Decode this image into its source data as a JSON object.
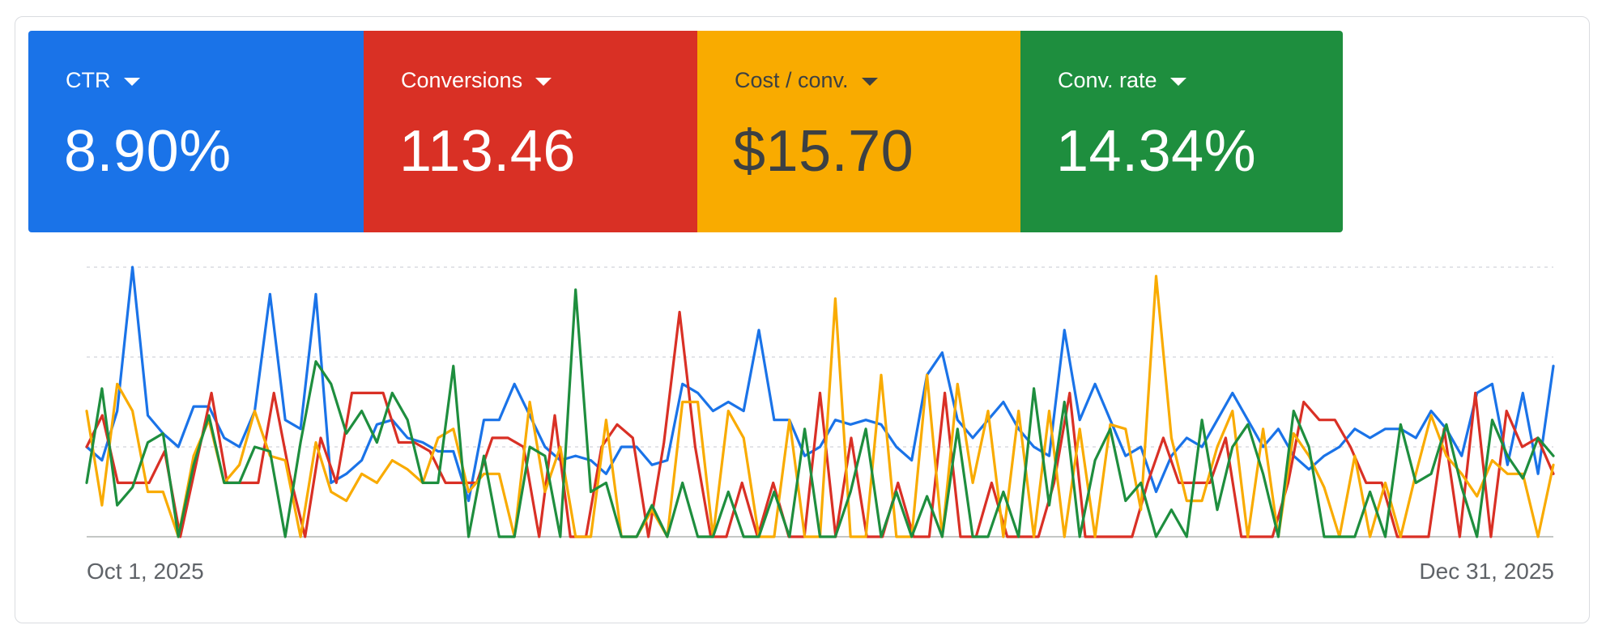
{
  "metrics": [
    {
      "label": "CTR",
      "value": "8.90%",
      "color": "#1a73e8",
      "text_color": "#ffffff"
    },
    {
      "label": "Conversions",
      "value": "113.46",
      "color": "#d93025",
      "text_color": "#ffffff"
    },
    {
      "label": "Cost / conv.",
      "value": "$15.70",
      "color": "#f9ab00",
      "text_color": "#3c4043"
    },
    {
      "label": "Conv. rate",
      "value": "14.34%",
      "color": "#1e8e3e",
      "text_color": "#ffffff"
    }
  ],
  "chart_data": {
    "type": "line",
    "x_start_label": "Oct 1, 2025",
    "x_end_label": "Dec 31, 2025",
    "ylim": [
      0,
      3
    ],
    "grid": true,
    "series": [
      {
        "color": "#1a73e8",
        "values": [
          1.0,
          0.85,
          1.4,
          3.0,
          1.35,
          1.15,
          1.0,
          1.45,
          1.45,
          1.1,
          1.0,
          1.4,
          2.7,
          1.3,
          1.2,
          2.7,
          0.6,
          0.7,
          0.85,
          1.25,
          1.3,
          1.1,
          1.05,
          0.95,
          0.95,
          0.4,
          1.3,
          1.3,
          1.7,
          1.35,
          1.0,
          0.85,
          0.9,
          0.85,
          0.7,
          1.0,
          1.0,
          0.8,
          0.85,
          1.7,
          1.6,
          1.4,
          1.5,
          1.4,
          2.3,
          1.3,
          1.3,
          0.9,
          1.0,
          1.3,
          1.25,
          1.3,
          1.25,
          1.0,
          0.85,
          1.8,
          2.05,
          1.3,
          1.1,
          1.3,
          1.5,
          1.2,
          1.0,
          0.9,
          2.3,
          1.3,
          1.7,
          1.3,
          0.9,
          1.0,
          0.5,
          0.9,
          1.1,
          1.0,
          1.3,
          1.6,
          1.3,
          1.0,
          1.2,
          0.9,
          0.75,
          0.9,
          1.0,
          1.2,
          1.1,
          1.2,
          1.2,
          1.1,
          1.4,
          1.2,
          0.9,
          1.6,
          1.7,
          0.8,
          1.6,
          0.7,
          1.9
        ]
      },
      {
        "color": "#d93025",
        "values": [
          1.0,
          1.35,
          0.6,
          0.6,
          0.6,
          0.95,
          0.0,
          0.8,
          1.6,
          0.6,
          0.6,
          0.6,
          1.6,
          0.7,
          0.0,
          1.1,
          0.6,
          1.6,
          1.6,
          1.6,
          1.05,
          1.05,
          0.95,
          0.6,
          0.6,
          0.6,
          1.1,
          1.1,
          1.0,
          0.0,
          1.35,
          0.0,
          0.0,
          1.0,
          1.25,
          1.1,
          0.0,
          1.05,
          2.5,
          1.0,
          0.0,
          0.0,
          0.6,
          0.0,
          0.6,
          0.0,
          0.0,
          1.6,
          0.0,
          1.1,
          0.0,
          0.0,
          0.6,
          0.0,
          0.0,
          1.6,
          0.0,
          0.0,
          0.6,
          0.0,
          0.0,
          0.0,
          0.6,
          1.6,
          0.0,
          0.0,
          0.0,
          0.0,
          0.6,
          1.1,
          0.6,
          0.6,
          0.6,
          1.1,
          0.0,
          0.0,
          0.0,
          0.6,
          1.5,
          1.3,
          1.3,
          1.0,
          0.6,
          0.6,
          0.0,
          0.0,
          0.0,
          1.2,
          0.0,
          1.6,
          0.0,
          1.4,
          1.0,
          1.1,
          0.7
        ]
      },
      {
        "color": "#f9ab00",
        "values": [
          1.4,
          0.35,
          1.7,
          1.4,
          0.5,
          0.5,
          0.0,
          0.9,
          1.3,
          0.6,
          0.8,
          1.4,
          0.9,
          0.85,
          0.0,
          1.05,
          0.5,
          0.4,
          0.7,
          0.6,
          0.85,
          0.75,
          0.6,
          1.1,
          1.2,
          0.5,
          0.7,
          0.7,
          0.0,
          1.5,
          0.5,
          1.0,
          0.0,
          0.0,
          1.3,
          0.0,
          0.0,
          0.3,
          0.0,
          1.5,
          1.5,
          0.0,
          1.4,
          1.1,
          0.0,
          0.0,
          1.3,
          0.0,
          0.0,
          2.65,
          0.0,
          0.0,
          1.8,
          0.0,
          0.0,
          1.8,
          0.0,
          1.7,
          0.6,
          1.4,
          0.0,
          1.4,
          0.0,
          1.4,
          0.0,
          1.2,
          0.0,
          1.25,
          1.2,
          0.3,
          2.9,
          1.1,
          0.4,
          0.4,
          1.0,
          1.4,
          0.0,
          1.2,
          0.0,
          1.15,
          0.9,
          0.55,
          0.0,
          0.9,
          0.0,
          0.6,
          0.0,
          0.7,
          1.35,
          0.9,
          0.7,
          0.45,
          0.85,
          0.7,
          0.7,
          0.0,
          0.8
        ]
      },
      {
        "color": "#1e8e3e",
        "values": [
          0.6,
          1.65,
          0.35,
          0.55,
          1.05,
          1.15,
          0.0,
          0.8,
          1.35,
          0.6,
          0.6,
          1.0,
          0.95,
          0.0,
          1.05,
          1.95,
          1.7,
          1.15,
          1.4,
          1.05,
          1.6,
          1.3,
          0.6,
          0.6,
          1.9,
          0.0,
          0.9,
          0.0,
          0.0,
          1.0,
          0.9,
          0.0,
          2.75,
          0.5,
          0.6,
          0.0,
          0.0,
          0.35,
          0.0,
          0.6,
          0.0,
          0.0,
          0.5,
          0.0,
          0.0,
          0.5,
          0.0,
          1.2,
          0.0,
          0.0,
          0.5,
          1.2,
          0.0,
          0.5,
          0.0,
          0.45,
          0.0,
          1.2,
          0.0,
          0.0,
          0.5,
          0.0,
          1.65,
          0.35,
          1.5,
          0.0,
          0.85,
          1.2,
          0.4,
          0.6,
          0.0,
          0.3,
          0.0,
          1.3,
          0.3,
          1.0,
          1.25,
          0.7,
          0.0,
          1.4,
          1.0,
          0.0,
          0.0,
          0.0,
          0.5,
          0.0,
          1.25,
          0.6,
          0.7,
          1.25,
          0.55,
          0.0,
          1.3,
          0.9,
          0.65,
          1.1,
          0.9
        ]
      }
    ]
  }
}
